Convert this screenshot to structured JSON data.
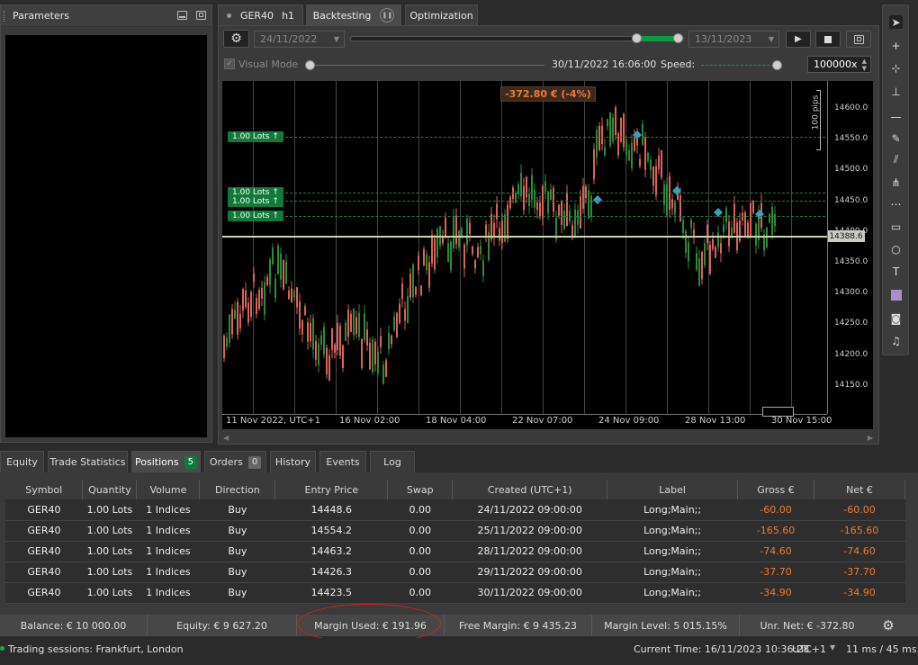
{
  "parameters_panel": {
    "title": "Parameters"
  },
  "top_tabs": {
    "symbol": "GER40",
    "timeframe": "h1",
    "backtesting": "Backtesting",
    "optimization": "Optimization"
  },
  "toolbar": {
    "start_date": "24/11/2022",
    "end_date": "13/11/2023",
    "visual_mode_label": "Visual Mode",
    "current_time": "30/11/2022 16:06:00",
    "speed_label": "Speed:",
    "speed_value": "100000x"
  },
  "chart": {
    "pnl_label": "-372.80 € (-4%)",
    "pips_label": "100 pips",
    "current_price": "14388.6",
    "lot_labels": [
      "1.00 Lots ↑",
      "1.00 Lots ↑",
      "1.00 Lots ↑",
      "1.00 Lots ↑"
    ],
    "price_ticks": [
      "14600.0",
      "14550.0",
      "14500.0",
      "14450.0",
      "14400.0",
      "14350.0",
      "14300.0",
      "14250.0",
      "14200.0",
      "14150.0"
    ],
    "time_ticks": [
      "11 Nov 2022, UTC+1",
      "16 Nov 02:00",
      "18 Nov 04:00",
      "22 Nov 07:00",
      "24 Nov 09:00",
      "28 Nov 13:00",
      "30 Nov 15:00"
    ]
  },
  "bottom_tabs": {
    "equity": "Equity",
    "trade_statistics": "Trade Statistics",
    "positions": "Positions",
    "positions_count": "5",
    "orders": "Orders",
    "orders_count": "0",
    "history": "History",
    "events": "Events",
    "log": "Log"
  },
  "positions_table": {
    "headers": [
      "Symbol",
      "Quantity",
      "Volume",
      "Direction",
      "Entry Price",
      "Swap",
      "Created (UTC+1)",
      "Label",
      "Gross €",
      "Net €"
    ],
    "rows": [
      [
        "GER40",
        "1.00 Lots",
        "1 Indices",
        "Buy",
        "14448.6",
        "0.00",
        "24/11/2022 09:00:00",
        "Long;Main;;",
        "-60.00",
        "-60.00"
      ],
      [
        "GER40",
        "1.00 Lots",
        "1 Indices",
        "Buy",
        "14554.2",
        "0.00",
        "25/11/2022 09:00:00",
        "Long;Main;;",
        "-165.60",
        "-165.60"
      ],
      [
        "GER40",
        "1.00 Lots",
        "1 Indices",
        "Buy",
        "14463.2",
        "0.00",
        "28/11/2022 09:00:00",
        "Long;Main;;",
        "-74.60",
        "-74.60"
      ],
      [
        "GER40",
        "1.00 Lots",
        "1 Indices",
        "Buy",
        "14426.3",
        "0.00",
        "29/11/2022 09:00:00",
        "Long;Main;;",
        "-37.70",
        "-37.70"
      ],
      [
        "GER40",
        "1.00 Lots",
        "1 Indices",
        "Buy",
        "14423.5",
        "0.00",
        "30/11/2022 09:00:00",
        "Long;Main;;",
        "-34.90",
        "-34.90"
      ]
    ]
  },
  "account": {
    "balance": "Balance: € 10 000.00",
    "equity": "Equity: € 9 627.20",
    "margin_used": "Margin Used: € 191.96",
    "free_margin": "Free Margin: € 9 435.23",
    "margin_level": "Margin Level: 5 015.15%",
    "unr_net": "Unr. Net: € -372.80"
  },
  "footer": {
    "trading_sessions": "Trading sessions: Frankfurt, London",
    "current_time": "Current Time:  16/11/2023 10:36:28",
    "timezone": "UTC+1",
    "latency": "11 ms / 45 ms"
  },
  "colors": {
    "negative": "#f07a30",
    "lot_green": "#0f7a3a",
    "bull_candle": "#2e8b3a",
    "bear_candle": "#d9645a",
    "price_line": "#cfd7a0"
  }
}
